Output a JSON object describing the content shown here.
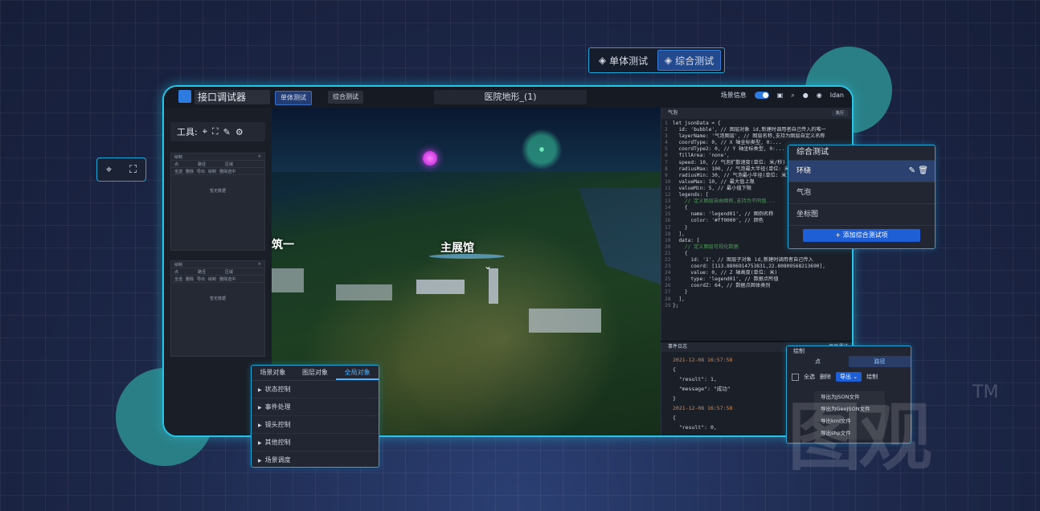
{
  "top_tabs": [
    "单体测试",
    "综合测试"
  ],
  "app": {
    "title": "接口调试器",
    "btn_single": "单体测试",
    "btn_combo": "综合测试",
    "doc_title": "医院地形_(1)",
    "scene_info": "场景信息",
    "user": "ldan"
  },
  "left_panel": {
    "tools_label": "工具:",
    "sub1_title": "绘制",
    "sub2_title": "绘制",
    "tab_a": "点",
    "tab_b": "路径",
    "tab_c": "区域",
    "act_all": "全选",
    "act_del": "删除",
    "act_export": "导出",
    "act_draw": "绘制",
    "act_clear": "删除选中",
    "empty": "暂无数据"
  },
  "view": {
    "label_main": "主展馆",
    "label_left": "筑一"
  },
  "code_panel": {
    "title": "气泡",
    "run": "执行",
    "lines": [
      "let jsonData = {",
      "  id: 'bubble', // 图层对象 id,新建时调用者自己传入的唯一",
      "  layerName: '气泡图层', // 图层名称,支持为图层自定义名称",
      "  coordType: 0, // X 轴坐标类型, 0:...",
      "  coordType2: 0, // Y 轴坐标类型, 0:...",
      "  fillArea: 'none',",
      "  speed: 10, // 气泡扩散速度(单位: 米/秒)",
      "  radiusMax: 100, // 气泡最大半径(单位: 米)",
      "  radiusMin: 30, // 气泡最小半径(单位: 米)",
      "  valueMax: 10, // 最大值上限",
      "  valueMin: 5, // 最小值下限",
      "  legends: [",
      "    // 定义图层自由图例,支持为不同值...",
      "    {",
      "      name: 'legend01', // 图例名称",
      "      color: '#ff0000', // 颜色",
      "    }",
      "  ],",
      "  data: [",
      "    // 定义图层可视化数据",
      "    {",
      "      id: '1', // 图层子对象 id,新建时调用者自己传入",
      "      coord: [113.8806914753831,22.80809568213690],",
      "      value: 0, // Z 轴高度(单位: 米)",
      "      type: 'legend01', // 数据点所值",
      "      coordZ: 64, // 数据点固体类别",
      "    }",
      "  ],",
      "};"
    ]
  },
  "log_panel": {
    "title": "事件日志",
    "toggle": "显示通过",
    "entries": [
      "2021-12-08 16:57:58",
      "{",
      "  \"result\": 1,",
      "  \"message\": \"成功\"",
      "}",
      "2021-12-08 16:57:58",
      "{",
      "  \"result\": 0,"
    ]
  },
  "test_panel": {
    "title": "综合测试",
    "items": [
      "环绕",
      "气泡",
      "坐标图"
    ],
    "add_button": "+ 添加综合测试项"
  },
  "ctrl_panel": {
    "tabs": [
      "场景对象",
      "图层对象",
      "全局对象"
    ],
    "rows": [
      "状态控制",
      "事件处理",
      "镜头控制",
      "其他控制",
      "场景调度"
    ]
  },
  "draw_panel": {
    "title": "绘制",
    "tabs": [
      "点",
      "路径"
    ],
    "select_all": "全选",
    "delete": "删除",
    "export": "导出",
    "draw": "绘制",
    "dropdown": [
      "导出为JSON文件",
      "导出为GeoJSON文件",
      "导出kml文件",
      "导出shp文件"
    ]
  },
  "watermark": {
    "text": "图观",
    "tm": "TM"
  }
}
